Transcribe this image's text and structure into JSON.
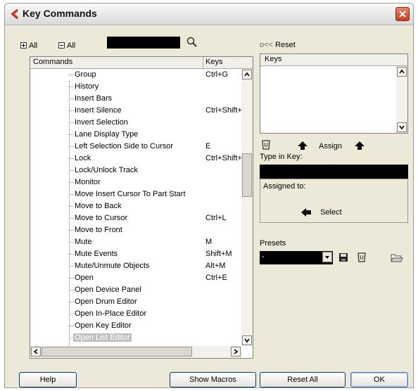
{
  "window": {
    "title": "Key Commands"
  },
  "toolbar": {
    "expand_all": "All",
    "collapse_all": "All"
  },
  "reset": {
    "prefix": "o<<",
    "label": "Reset"
  },
  "commands": {
    "col_commands": "Commands",
    "col_keys": "Keys",
    "rows": [
      {
        "label": "Group",
        "key": "Ctrl+G"
      },
      {
        "label": "History",
        "key": ""
      },
      {
        "label": "Insert Bars",
        "key": ""
      },
      {
        "label": "Insert Silence",
        "key": "Ctrl+Shift+"
      },
      {
        "label": "Invert Selection",
        "key": ""
      },
      {
        "label": "Lane Display Type",
        "key": ""
      },
      {
        "label": "Left Selection Side to Cursor",
        "key": "E"
      },
      {
        "label": "Lock",
        "key": "Ctrl+Shift+"
      },
      {
        "label": "Lock/Unlock Track",
        "key": ""
      },
      {
        "label": "Monitor",
        "key": ""
      },
      {
        "label": "Move Insert Cursor To Part Start",
        "key": ""
      },
      {
        "label": "Move to Back",
        "key": ""
      },
      {
        "label": "Move to Cursor",
        "key": "Ctrl+L"
      },
      {
        "label": "Move to Front",
        "key": ""
      },
      {
        "label": "Mute",
        "key": "M"
      },
      {
        "label": "Mute Events",
        "key": "Shift+M"
      },
      {
        "label": "Mute/Unmute Objects",
        "key": "Alt+M"
      },
      {
        "label": "Open",
        "key": "Ctrl+E"
      },
      {
        "label": "Open Device Panel",
        "key": ""
      },
      {
        "label": "Open Drum Editor",
        "key": ""
      },
      {
        "label": "Open In-Place Editor",
        "key": ""
      },
      {
        "label": "Open Key Editor",
        "key": ""
      },
      {
        "label": "Open List Editor",
        "key": ""
      }
    ]
  },
  "keys_panel": {
    "header": "Keys"
  },
  "assign": {
    "label": "Assign"
  },
  "type_in": {
    "label": "Type in Key:"
  },
  "assigned": {
    "label": "Assigned to:",
    "select_label": "Select"
  },
  "presets": {
    "label": "Presets",
    "value": "-"
  },
  "buttons": {
    "help": "Help",
    "show_macros": "Show Macros",
    "reset_all": "Reset All",
    "ok": "OK"
  }
}
